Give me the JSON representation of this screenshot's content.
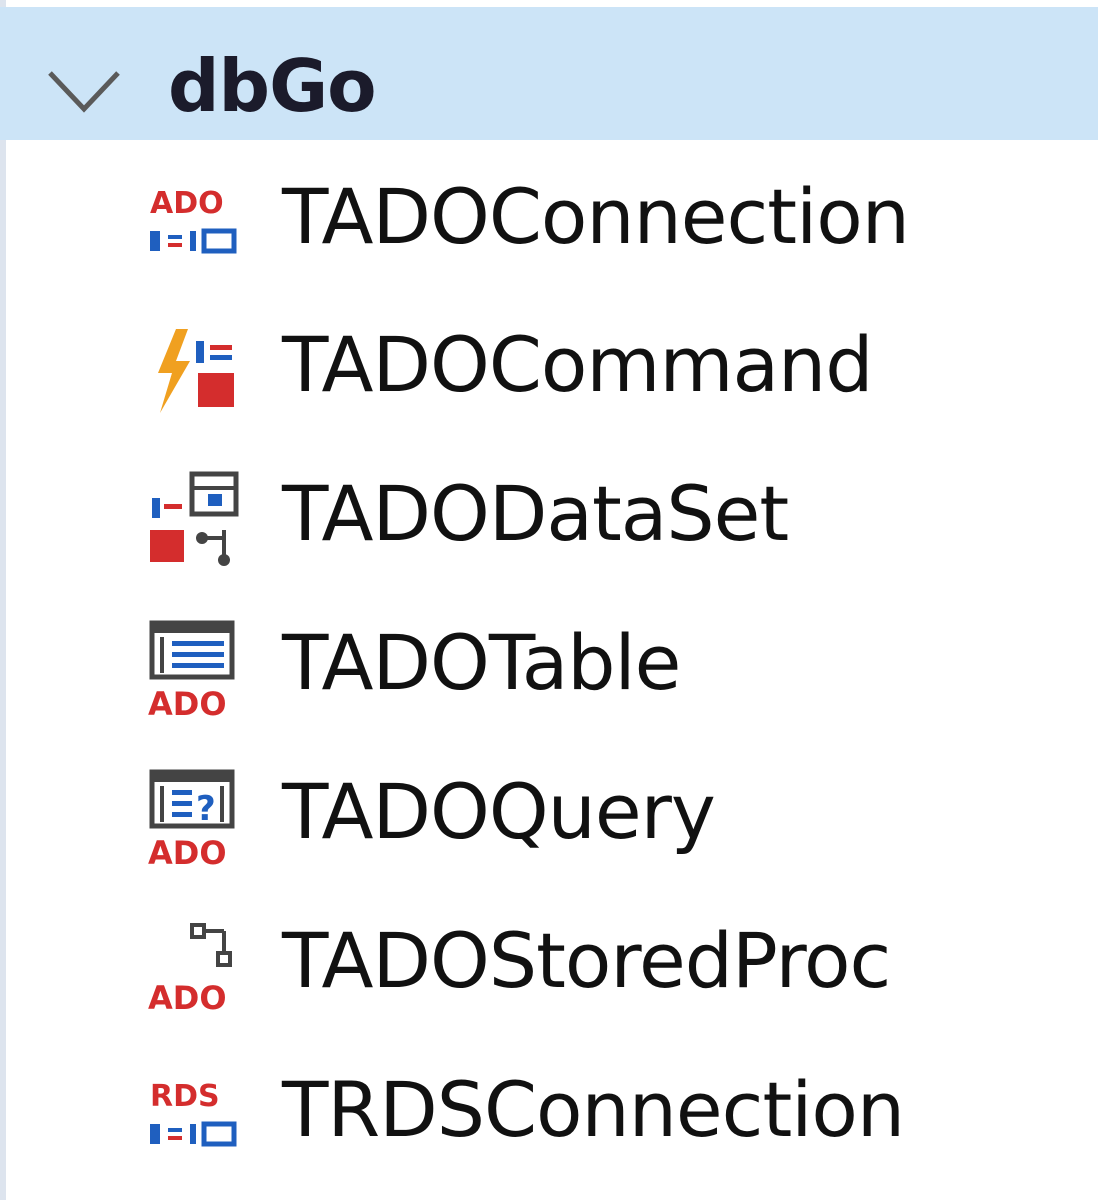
{
  "category": {
    "label": "dbGo",
    "expanded": true,
    "header_color": "#cce4f7"
  },
  "items": [
    {
      "label": "TADOConnection",
      "icon": "ado-connection-icon"
    },
    {
      "label": "TADOCommand",
      "icon": "ado-command-icon"
    },
    {
      "label": "TADODataSet",
      "icon": "ado-dataset-icon"
    },
    {
      "label": "TADOTable",
      "icon": "ado-table-icon"
    },
    {
      "label": "TADOQuery",
      "icon": "ado-query-icon"
    },
    {
      "label": "TADOStoredProc",
      "icon": "ado-storedproc-icon"
    },
    {
      "label": "TRDSConnection",
      "icon": "rds-connection-icon"
    }
  ],
  "icon_text": {
    "ado": "ADO",
    "rds": "RDS"
  },
  "colors": {
    "icon_red": "#d42d2d",
    "icon_blue": "#1f5fbf",
    "icon_orange": "#f0a020",
    "icon_gray": "#444444"
  }
}
